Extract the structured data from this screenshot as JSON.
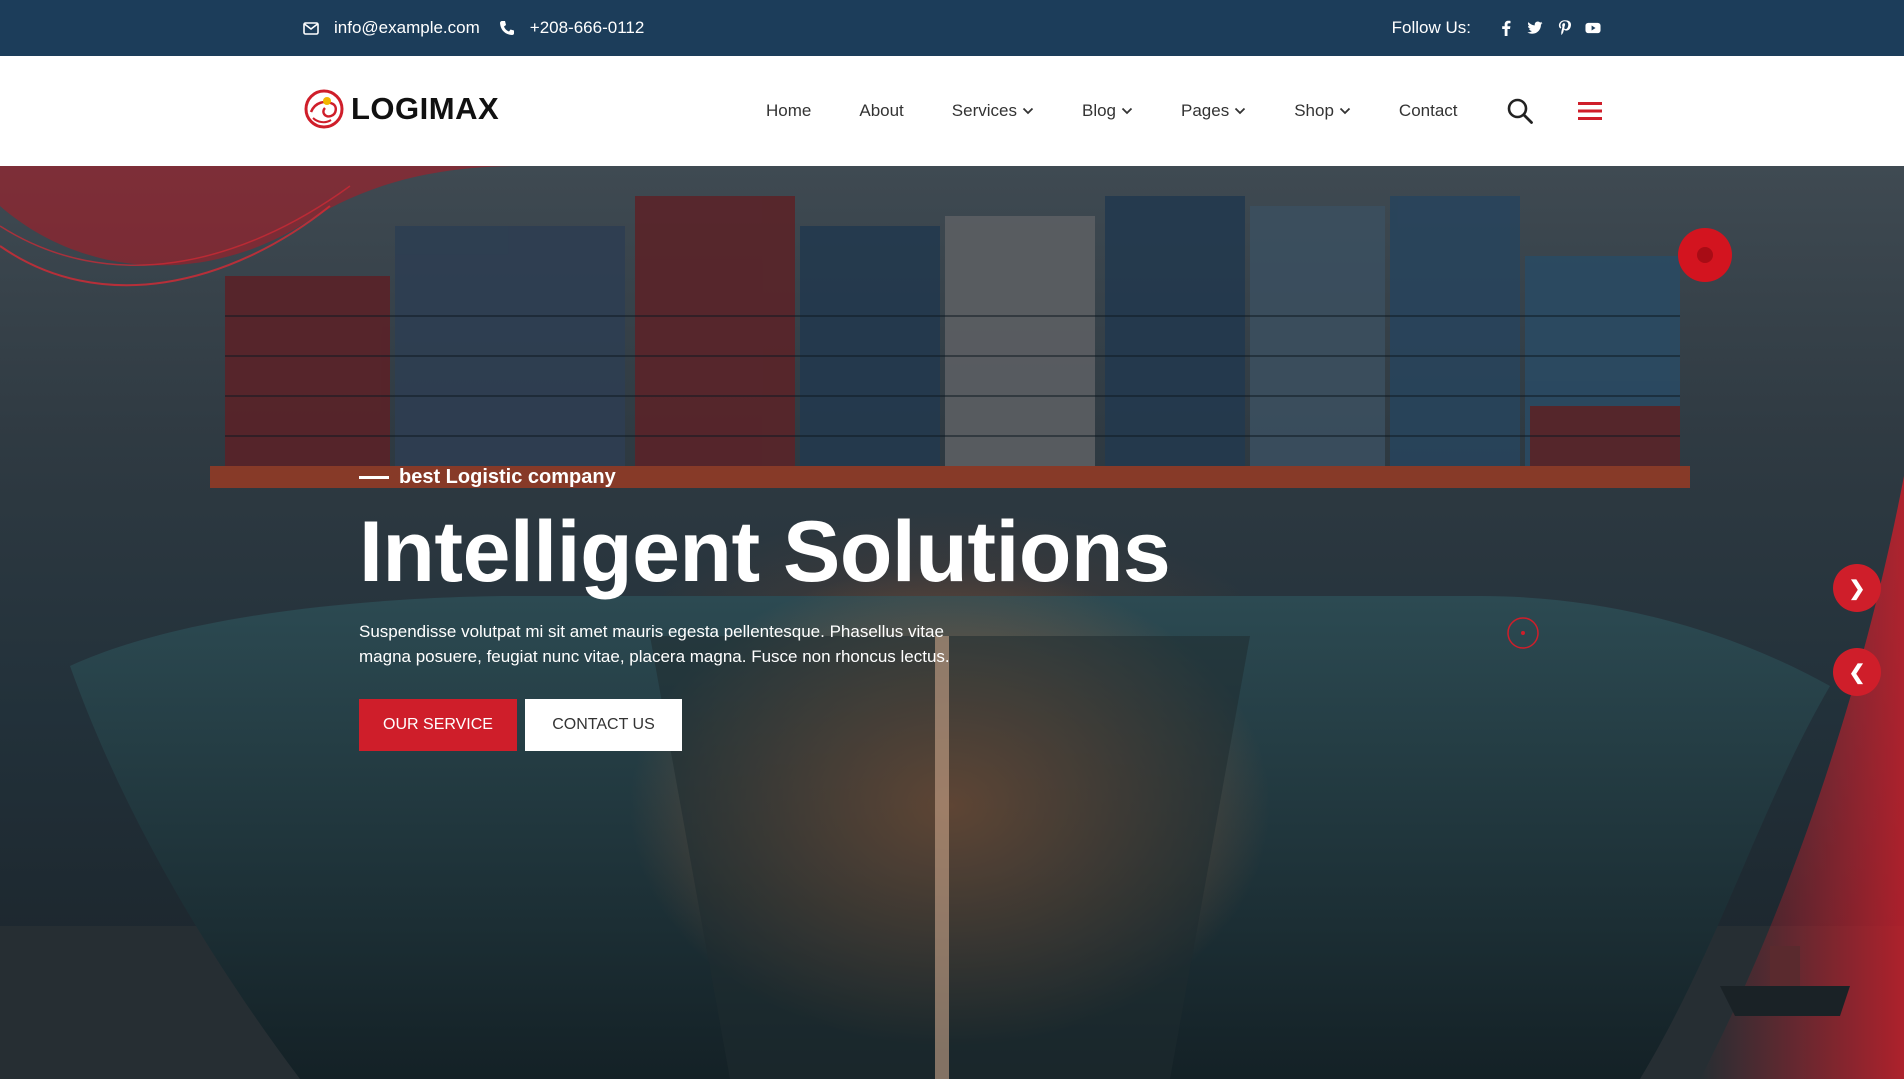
{
  "topbar": {
    "email": "info@example.com",
    "phone": "+208-666-0112",
    "follow_label": "Follow Us:"
  },
  "header": {
    "logo_text": "LOGIMAX",
    "nav": [
      {
        "label": "Home",
        "dropdown": false
      },
      {
        "label": "About",
        "dropdown": false
      },
      {
        "label": "Services",
        "dropdown": true
      },
      {
        "label": "Blog",
        "dropdown": true
      },
      {
        "label": "Pages",
        "dropdown": true
      },
      {
        "label": "Shop",
        "dropdown": true
      },
      {
        "label": "Contact",
        "dropdown": false
      }
    ]
  },
  "hero": {
    "tagline": "best Logistic company",
    "headline": "Intelligent Solutions",
    "description": "Suspendisse volutpat mi sit amet mauris egesta pellentesque. Phasellus vitae magna posuere, feugiat nunc vitae, placera magna. Fusce non rhoncus lectus.",
    "primary_button": "OUR SERVICE",
    "secondary_button": "CONTACT US",
    "next_arrow": "❯",
    "prev_arrow": "❮"
  },
  "icons": {
    "email": "envelope-icon",
    "phone": "phone-icon",
    "social": [
      "facebook-icon",
      "twitter-icon",
      "pinterest-icon",
      "youtube-icon"
    ],
    "search": "search-icon",
    "menu": "hamburger-menu-icon"
  },
  "colors": {
    "topbar_bg": "#1c3d5a",
    "accent": "#cf1e2a",
    "header_bg": "#ffffff"
  }
}
